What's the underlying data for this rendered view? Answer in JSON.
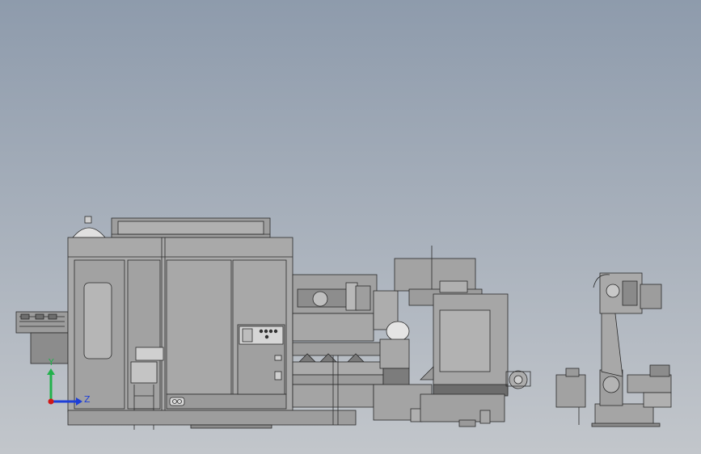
{
  "viewport": {
    "background_top": "#8e9bac",
    "background_bottom": "#c2c6cb"
  },
  "triad": {
    "y_label": "Y",
    "z_label": "Z",
    "y_color": "#22b14c",
    "z_color": "#1e3fd8",
    "origin_color": "#d01818"
  },
  "palette": {
    "body": "#a5a5a5",
    "body_light": "#b8b8b8",
    "body_dark": "#8c8c8c",
    "line": "#2a2a2a",
    "panel": "#d6d6d6",
    "base": "#6e6e6e"
  }
}
